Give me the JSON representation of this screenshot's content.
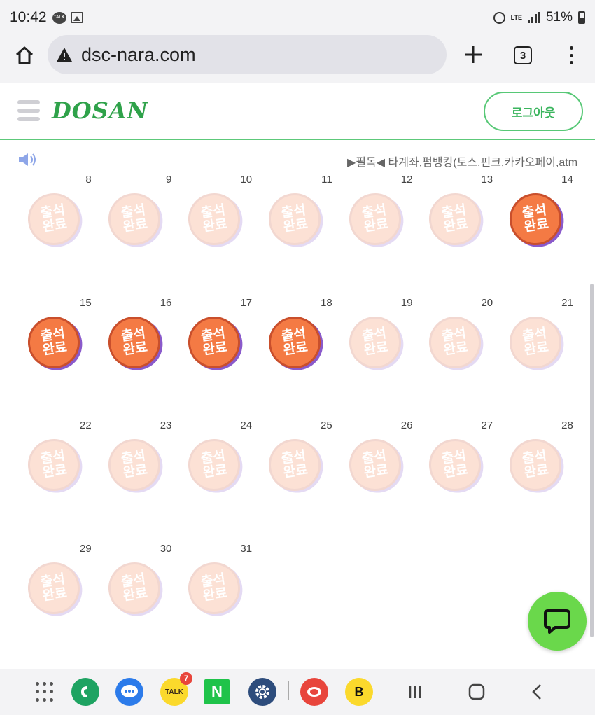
{
  "status_bar": {
    "time": "10:42",
    "talk_label": "TALK",
    "network": "LTE",
    "battery": "51%"
  },
  "browser": {
    "url": "dsc-nara.com",
    "tab_count": "3"
  },
  "site": {
    "logo": "DOSAN",
    "logout_label": "로그아웃",
    "notice": "▶필독◀ 타계좌,펌뱅킹(토스,핀크,카카오페이,atm"
  },
  "calendar": {
    "stamp_line1": "출석",
    "stamp_line2": "완료",
    "rows": [
      [
        {
          "day": "8",
          "done": false
        },
        {
          "day": "9",
          "done": false
        },
        {
          "day": "10",
          "done": false
        },
        {
          "day": "11",
          "done": false
        },
        {
          "day": "12",
          "done": false
        },
        {
          "day": "13",
          "done": false
        },
        {
          "day": "14",
          "done": true
        }
      ],
      [
        {
          "day": "15",
          "done": true
        },
        {
          "day": "16",
          "done": true
        },
        {
          "day": "17",
          "done": true
        },
        {
          "day": "18",
          "done": true
        },
        {
          "day": "19",
          "done": false
        },
        {
          "day": "20",
          "done": false
        },
        {
          "day": "21",
          "done": false
        }
      ],
      [
        {
          "day": "22",
          "done": false
        },
        {
          "day": "23",
          "done": false
        },
        {
          "day": "24",
          "done": false
        },
        {
          "day": "25",
          "done": false
        },
        {
          "day": "26",
          "done": false
        },
        {
          "day": "27",
          "done": false
        },
        {
          "day": "28",
          "done": false
        }
      ],
      [
        {
          "day": "29",
          "done": false
        },
        {
          "day": "30",
          "done": false
        },
        {
          "day": "31",
          "done": false
        }
      ]
    ]
  },
  "nav": {
    "kakao_badge": "7",
    "kakaotalk_label": "TALK",
    "naver_label": "N",
    "b_label": "B"
  },
  "colors": {
    "accent_green": "#3bb55e",
    "stamp_orange": "#f47a44",
    "stamp_shadow": "#8a5acb"
  }
}
